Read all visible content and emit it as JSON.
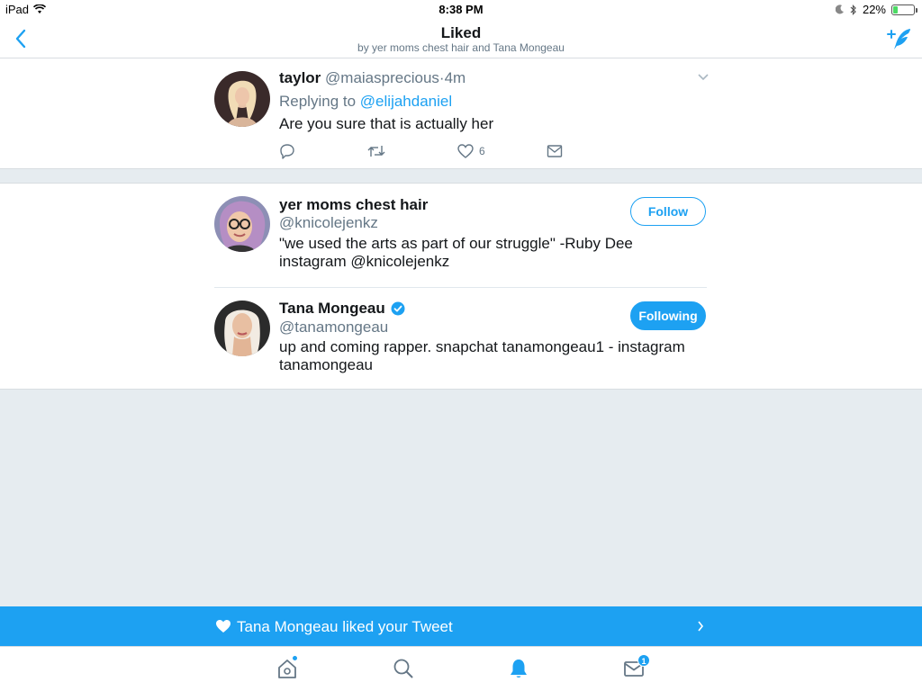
{
  "status_bar": {
    "device": "iPad",
    "time": "8:38 PM",
    "battery_percent_label": "22%",
    "battery_level": 0.22
  },
  "nav": {
    "title": "Liked",
    "subtitle": "by yer moms chest hair and Tana Mongeau",
    "back_icon": "chevron-left-icon",
    "compose_icon": "compose-quill-icon"
  },
  "tweet": {
    "name": "taylor",
    "handle": "@maiasprecious",
    "separator": "·",
    "time": "4m",
    "replying_prefix": "Replying to",
    "replying_to": "@elijahdaniel",
    "text": "Are you sure that is actually her",
    "like_count": "6"
  },
  "users": [
    {
      "name": "yer moms chest hair",
      "handle": "@knicolejenkz",
      "bio": "\"we used the arts as part of our struggle\" -Ruby Dee instagram @knicolejenkz",
      "button": "Follow",
      "verified": false
    },
    {
      "name": "Tana Mongeau",
      "handle": "@tanamongeau",
      "bio": "up and coming rapper. snapchat tanamongeau1 - instagram tanamongeau",
      "button": "Following",
      "verified": true
    }
  ],
  "banner": {
    "text": "Tana Mongeau liked your Tweet"
  },
  "tab_bar": {
    "messages_badge": "1"
  },
  "colors": {
    "accent": "#1da1f2",
    "background": "#e6ecf0",
    "secondary_text": "#657786"
  }
}
